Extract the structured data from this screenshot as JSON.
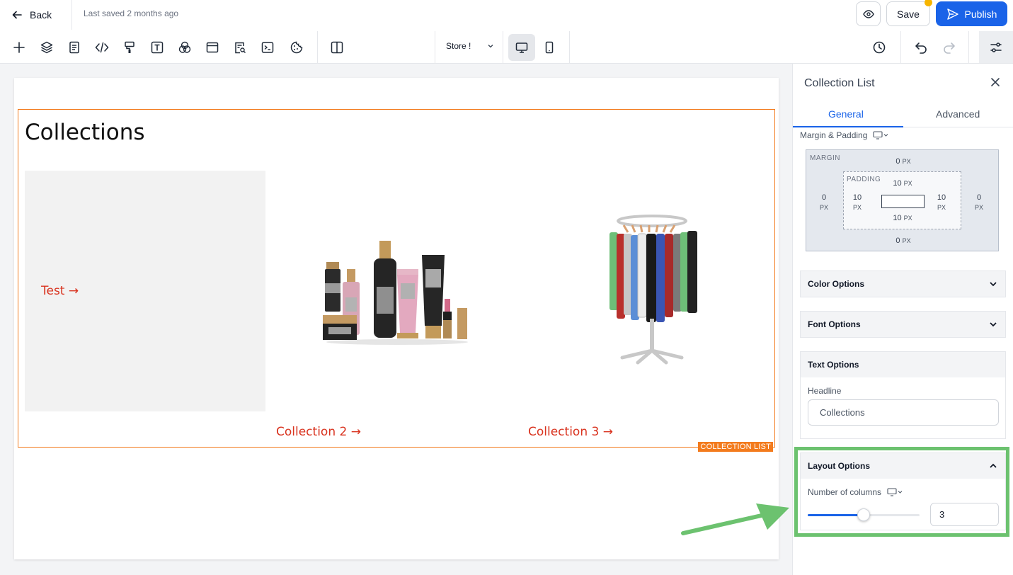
{
  "header": {
    "back_label": "Back",
    "last_saved": "Last saved 2 months ago",
    "save_label": "Save",
    "publish_label": "Publish"
  },
  "toolbar": {
    "tools": [
      "plus-icon",
      "layers-icon",
      "pages-icon",
      "code-icon",
      "paint-roller-icon",
      "text-icon",
      "color-circles-icon",
      "section-icon",
      "search-document-icon",
      "terminal-icon",
      "cookie-icon",
      "split-view-icon"
    ],
    "store_select": "Store !"
  },
  "canvas": {
    "headline": "Collections",
    "collections": [
      {
        "label": "Test →",
        "image": "none"
      },
      {
        "label": "Collection 2 →",
        "image": "cosmetics"
      },
      {
        "label": "Collection 3 →",
        "image": "clothing-rack"
      }
    ],
    "block_badge": "COLLECTION LIST"
  },
  "panel": {
    "title": "Collection List",
    "tabs": [
      "General",
      "Advanced"
    ],
    "active_tab": "General",
    "margin_padding_label": "Margin & Padding",
    "margin_caption": "MARGIN",
    "padding_caption": "PADDING",
    "unit": "PX",
    "margin": {
      "top": "0",
      "right": "0",
      "bottom": "0",
      "left": "0"
    },
    "padding": {
      "top": "10",
      "right": "10",
      "bottom": "10",
      "left": "10"
    },
    "sections": {
      "color": "Color Options",
      "font": "Font Options",
      "text": "Text Options",
      "layout": "Layout Options"
    },
    "headline_label": "Headline",
    "headline_value": "Collections",
    "columns_label": "Number of columns",
    "columns_value": "3",
    "columns_slider_fraction": 0.5
  },
  "colors": {
    "accent": "#1a63e8",
    "link": "#d9331f",
    "selection": "#f37b1d",
    "highlight": "#6cc26f"
  }
}
